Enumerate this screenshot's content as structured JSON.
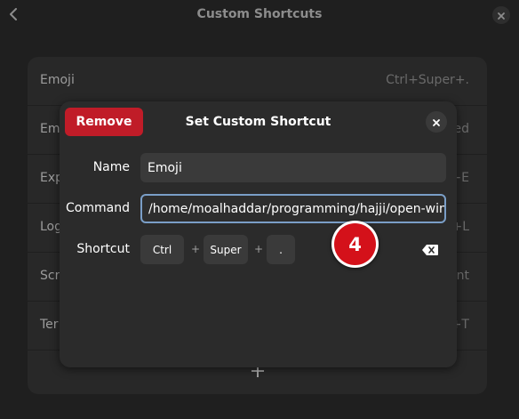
{
  "header": {
    "title": "Custom Shortcuts"
  },
  "list": {
    "rows": [
      {
        "name": "Emoji",
        "accel": "Ctrl+Super+."
      },
      {
        "name": "Em",
        "accel": "ed"
      },
      {
        "name": "Exp",
        "accel": "+E"
      },
      {
        "name": "Log",
        "accel": "+L"
      },
      {
        "name": "Scr",
        "accel": "nt"
      },
      {
        "name": "Ter",
        "accel": "+T"
      }
    ],
    "add_icon": "plus-icon"
  },
  "dialog": {
    "title": "Set Custom Shortcut",
    "remove_label": "Remove",
    "name_label": "Name",
    "name_value": "Emoji",
    "command_label": "Command",
    "command_value": "/home/moalhaddar/programming/hajji/open-winc",
    "shortcut_label": "Shortcut",
    "keys": [
      "Ctrl",
      "Super",
      "."
    ],
    "plus": "+",
    "clear_icon": "backspace-icon"
  },
  "annotation": {
    "step": "4"
  },
  "colors": {
    "destructive": "#c01c28",
    "focus": "#7a9ec7",
    "badge": "#d4111a"
  }
}
